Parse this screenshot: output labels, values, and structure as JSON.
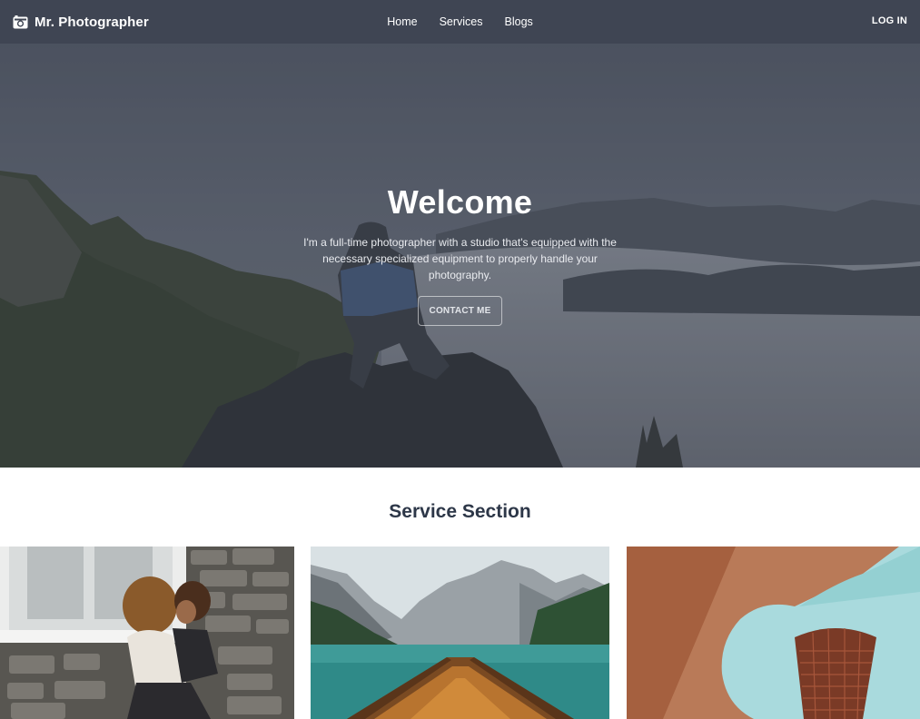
{
  "navbar": {
    "brand": "Mr. Photographer",
    "brand_icon": "camera-icon",
    "links": [
      {
        "label": "Home"
      },
      {
        "label": "Services"
      },
      {
        "label": "Blogs"
      }
    ],
    "login_label": "LOG IN",
    "background": "#3f4553"
  },
  "hero": {
    "title": "Welcome",
    "description": "I'm a full-time photographer with a studio that's equipped with the necessary specialized equipment to properly handle your photography.",
    "cta_label": "CONTACT ME"
  },
  "services": {
    "title": "Service Section"
  }
}
